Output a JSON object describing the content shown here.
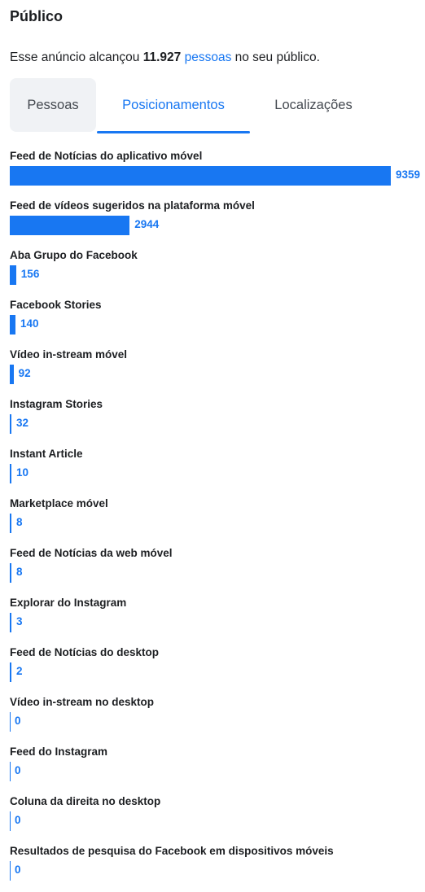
{
  "title": "Público",
  "summary": {
    "prefix": "Esse anúncio alcançou ",
    "count": "11.927",
    "link": "pessoas",
    "suffix": " no seu público."
  },
  "tabs": [
    {
      "label": "Pessoas",
      "active": false
    },
    {
      "label": "Posicionamentos",
      "active": true
    },
    {
      "label": "Localizações",
      "active": false
    }
  ],
  "accent_color": "#1877f2",
  "placements": [
    {
      "label": "Feed de Notícias do aplicativo móvel",
      "value": 9359
    },
    {
      "label": "Feed de vídeos sugeridos na plataforma móvel",
      "value": 2944
    },
    {
      "label": "Aba Grupo do Facebook",
      "value": 156
    },
    {
      "label": "Facebook Stories",
      "value": 140
    },
    {
      "label": "Vídeo in-stream móvel",
      "value": 92
    },
    {
      "label": "Instagram Stories",
      "value": 32
    },
    {
      "label": "Instant Article",
      "value": 10
    },
    {
      "label": "Marketplace móvel",
      "value": 8
    },
    {
      "label": "Feed de Notícias da web móvel",
      "value": 8
    },
    {
      "label": "Explorar do Instagram",
      "value": 3
    },
    {
      "label": "Feed de Notícias do desktop",
      "value": 2
    },
    {
      "label": "Vídeo in-stream no desktop",
      "value": 0
    },
    {
      "label": "Feed do Instagram",
      "value": 0
    },
    {
      "label": "Coluna da direita no desktop",
      "value": 0
    },
    {
      "label": "Resultados de pesquisa do Facebook em dispositivos móveis",
      "value": 0
    }
  ]
}
